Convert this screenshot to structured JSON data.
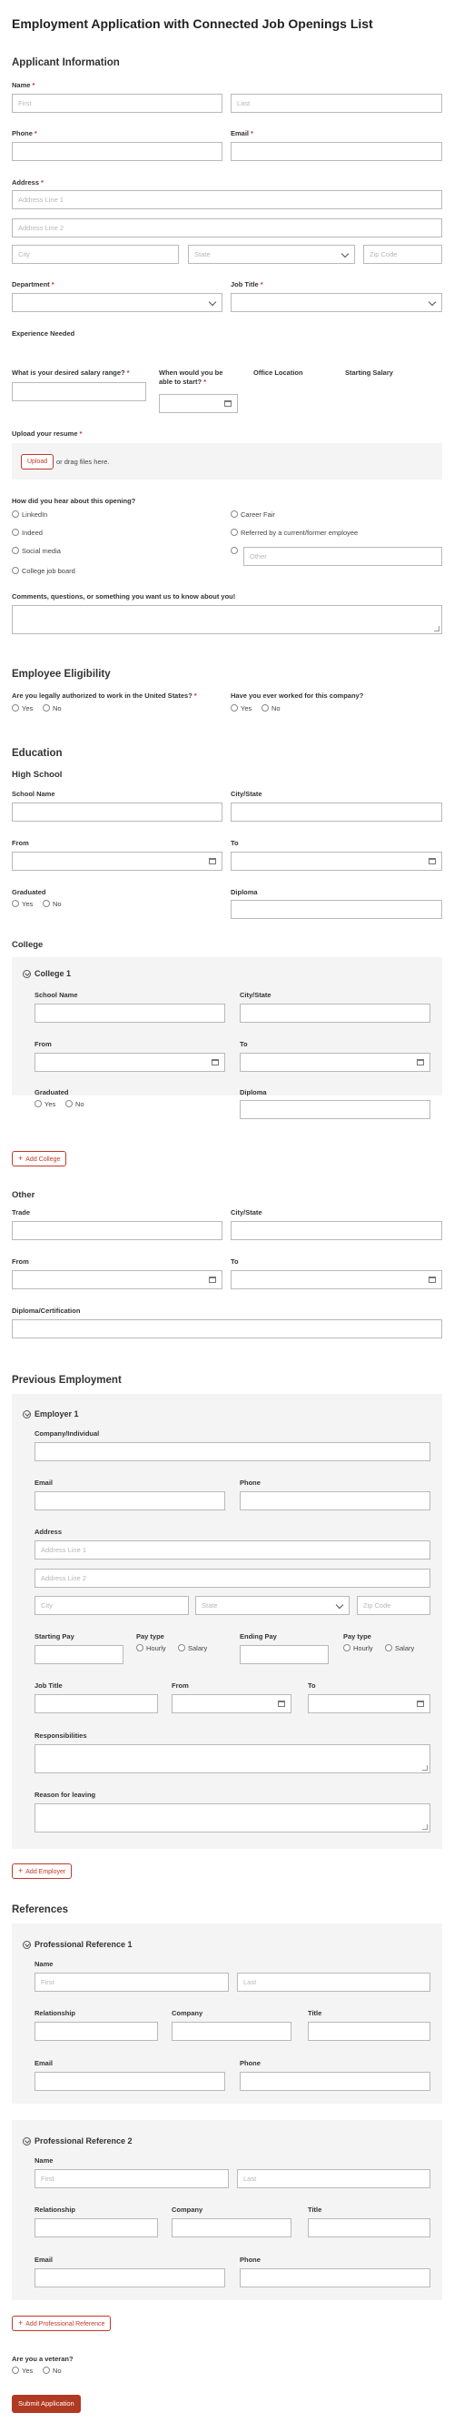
{
  "form": {
    "title": "Employment Application with Connected Job Openings List",
    "submit_label": "Submit Application"
  },
  "applicant": {
    "heading": "Applicant Information",
    "name_label": "Name",
    "first_ph": "First",
    "last_ph": "Last",
    "phone_label": "Phone",
    "email_label": "Email",
    "address_label": "Address",
    "addr1_ph": "Address Line 1",
    "addr2_ph": "Address Line 2",
    "city_ph": "City",
    "state_ph": "State",
    "zip_ph": "Zip Code",
    "department_label": "Department",
    "job_title_label": "Job Title",
    "experience_label": "Experience Needed",
    "salary_label": "What is your desired salary range?",
    "start_label": "When would you be able to start?",
    "office_label": "Office Location",
    "starting_salary_label": "Starting Salary",
    "resume_label": "Upload your resume",
    "upload_btn": "Upload",
    "drag_text": "or drag files here.",
    "hear_label": "How did you hear about this opening?",
    "hear_options": [
      "LinkedIn",
      "Indeed",
      "Social media",
      "College job board",
      "Career Fair",
      "Referred by a current/former employee"
    ],
    "other_ph": "Other",
    "comments_label": "Comments, questions, or something you want us to know about you!"
  },
  "eligibility": {
    "heading": "Employee Eligibility",
    "authorized_label": "Are you legally authorized to work in the United States?",
    "worked_label": "Have you ever worked for this company?",
    "yes": "Yes",
    "no": "No"
  },
  "education": {
    "heading": "Education",
    "high_school": "High School",
    "school_name": "School Name",
    "city_state": "City/State",
    "from": "From",
    "to": "To",
    "graduated": "Graduated",
    "diploma": "Diploma",
    "college": "College",
    "college_item": "College 1",
    "add_college": "Add College",
    "other": "Other",
    "trade": "Trade",
    "diploma_cert": "Diploma/Certification"
  },
  "employment": {
    "heading": "Previous Employment",
    "employer_item": "Employer 1",
    "company": "Company/Individual",
    "email": "Email",
    "phone": "Phone",
    "address": "Address",
    "starting_pay": "Starting Pay",
    "pay_type": "Pay type",
    "ending_pay": "Ending Pay",
    "hourly": "Hourly",
    "salary": "Salary",
    "job_title": "Job Title",
    "from": "From",
    "to": "To",
    "responsibilities": "Responsibilities",
    "reason": "Reason for leaving",
    "add_employer": "Add Employer"
  },
  "references": {
    "heading": "References",
    "ref1": "Professional Reference 1",
    "ref2": "Professional Reference 2",
    "name": "Name",
    "relationship": "Relationship",
    "company": "Company",
    "title": "Title",
    "email": "Email",
    "phone": "Phone",
    "add_reference": "Add Professional Reference",
    "veteran_label": "Are you a veteran?"
  }
}
